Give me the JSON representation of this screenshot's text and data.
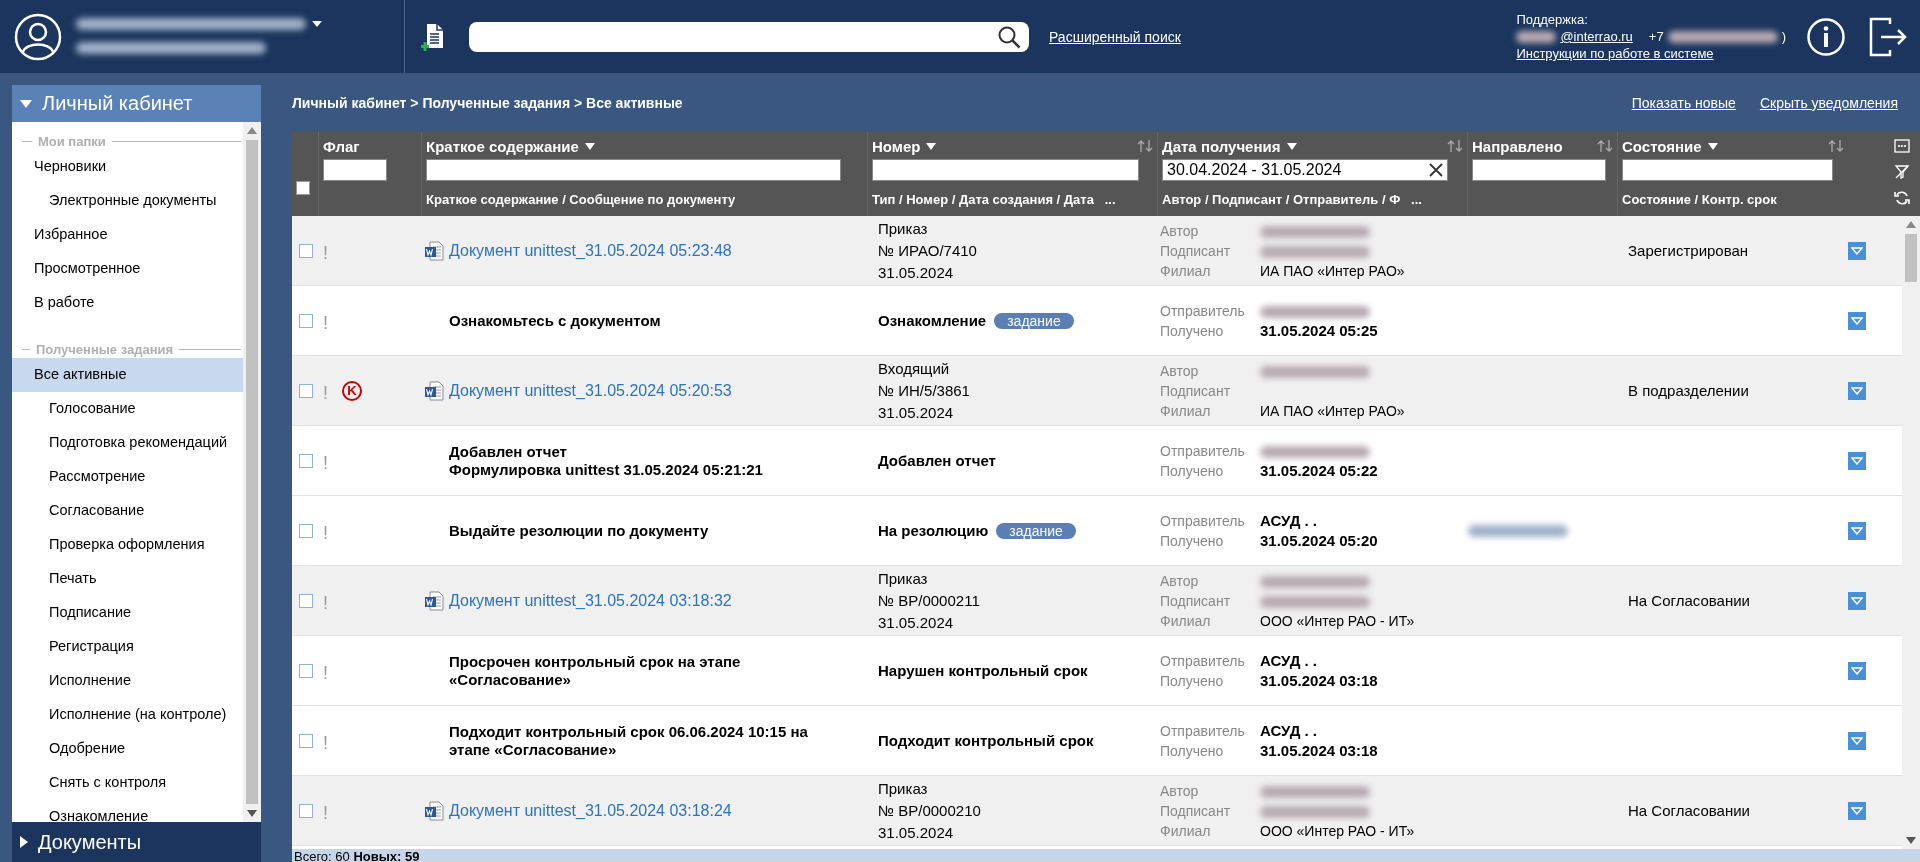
{
  "header": {
    "user": {
      "name_redacted": true,
      "org_redacted": true
    },
    "advanced_search": "Расширенный поиск",
    "support": {
      "label": "Поддержка:",
      "email_redacted": true,
      "email": "@interrao.ru",
      "phone": "+7",
      "phone_redacted": true,
      "phone_end": ")",
      "link": "Инструкции по работе в системе"
    }
  },
  "sidebar": {
    "panels": [
      {
        "title": "Личный кабинет",
        "expanded": true,
        "sections": [
          {
            "title": "Мои папки",
            "items": [
              {
                "label": "Черновики",
                "selected": false,
                "children": [
                  {
                    "label": "Электронные документы",
                    "selected": false
                  }
                ]
              },
              {
                "label": "Избранное",
                "selected": false
              },
              {
                "label": "Просмотренное",
                "selected": false
              },
              {
                "label": "В работе",
                "selected": false
              }
            ]
          },
          {
            "title": "Полученные задания",
            "items": [
              {
                "label": "Все активные",
                "selected": true,
                "children": [
                  {
                    "label": "Голосование",
                    "selected": false
                  },
                  {
                    "label": "Подготовка рекомендаций",
                    "selected": false
                  },
                  {
                    "label": "Рассмотрение",
                    "selected": false
                  },
                  {
                    "label": "Согласование",
                    "selected": false
                  },
                  {
                    "label": "Проверка оформления",
                    "selected": false
                  },
                  {
                    "label": "Печать",
                    "selected": false
                  },
                  {
                    "label": "Подписание",
                    "selected": false
                  },
                  {
                    "label": "Регистрация",
                    "selected": false
                  },
                  {
                    "label": "Исполнение",
                    "selected": false
                  },
                  {
                    "label": "Исполнение (на контроле)",
                    "selected": false
                  },
                  {
                    "label": "Одобрение",
                    "selected": false
                  },
                  {
                    "label": "Снять с контроля",
                    "selected": false
                  },
                  {
                    "label": "Ознакомление",
                    "selected": false
                  }
                ]
              }
            ]
          }
        ]
      },
      {
        "title": "Документы",
        "expanded": false
      }
    ]
  },
  "breadcrumb": "Личный кабинет > Полученные задания > Все активные",
  "actions": [
    "Показать новые",
    "Скрыть уведомления"
  ],
  "table": {
    "select_all": {
      "checked": false
    },
    "columns": [
      {
        "label": "Флаг",
        "menu": false,
        "sortable": false
      },
      {
        "label": "Краткое содержание",
        "menu": true,
        "sortable": false,
        "subheader": "Краткое содержание / Сообщение по документу"
      },
      {
        "label": "Номер",
        "menu": true,
        "sortable": true,
        "subheader": "Тип / Номер / Дата создания / Дата   ..."
      },
      {
        "label": "Дата получения",
        "menu": true,
        "sortable": true,
        "filter_value": "30.04.2024 - 31.05.2024",
        "clearable": true,
        "subheader": "Автор / Подписант / Отправитель / Ф   ..."
      },
      {
        "label": "Направлено",
        "menu": false,
        "sortable": true
      },
      {
        "label": "Состояние",
        "menu": true,
        "sortable": true,
        "subheader": "Состояние / Контр. срок"
      }
    ],
    "rows": [
      {
        "kind": "document",
        "checked": false,
        "flag": "!",
        "title": "Документ unittest_31.05.2024 05:23:48",
        "type": "Приказ",
        "number": "№ ИРАО/7410",
        "date": "31.05.2024",
        "people": [
          {
            "label": "Автор",
            "redacted": true
          },
          {
            "label": "Подписант",
            "redacted": true
          },
          {
            "label": "Филиал",
            "value": "ИА ПАО «Интер РАО»"
          }
        ],
        "status": "Зарегистрирован"
      },
      {
        "kind": "task",
        "checked": false,
        "flag": "!",
        "title": "Ознакомьтесь с документом",
        "task_type": "Ознакомление",
        "badge": "задание",
        "people": [
          {
            "label": "Отправитель",
            "redacted": true
          },
          {
            "label": "Получено",
            "value": "31.05.2024 05:25"
          }
        ]
      },
      {
        "kind": "document",
        "checked": false,
        "flag": "!",
        "control": "K",
        "title": "Документ unittest_31.05.2024 05:20:53",
        "type": "Входящий",
        "number": "№ ИН/5/3861",
        "date": "31.05.2024",
        "people": [
          {
            "label": "Автор",
            "redacted": true
          },
          {
            "label": "Подписант"
          },
          {
            "label": "Филиал",
            "value": "ИА ПАО «Интер РАО»"
          }
        ],
        "status": "В подразделении"
      },
      {
        "kind": "task",
        "checked": false,
        "flag": "!",
        "title": "Добавлен отчет\nФормулировка unittest 31.05.2024 05:21:21",
        "task_type": "Добавлен отчет",
        "people": [
          {
            "label": "Отправитель",
            "redacted": true
          },
          {
            "label": "Получено",
            "value": "31.05.2024 05:22"
          }
        ]
      },
      {
        "kind": "task",
        "checked": false,
        "flag": "!",
        "title": "Выдайте резолюции по документу",
        "task_type": "На резолюцию",
        "badge": "задание",
        "people": [
          {
            "label": "Отправитель",
            "value": "АСУД . ."
          },
          {
            "label": "Получено",
            "value": "31.05.2024 05:20"
          }
        ],
        "directed_redacted": true
      },
      {
        "kind": "document",
        "checked": false,
        "flag": "!",
        "title": "Документ unittest_31.05.2024 03:18:32",
        "type": "Приказ",
        "number": "№ ВР/0000211",
        "date": "31.05.2024",
        "people": [
          {
            "label": "Автор",
            "redacted": true
          },
          {
            "label": "Подписант",
            "redacted": true
          },
          {
            "label": "Филиал",
            "value": "ООО «Интер РАО - ИТ»"
          }
        ],
        "status": "На Согласовании"
      },
      {
        "kind": "task",
        "checked": false,
        "flag": "!",
        "title": "Просрочен контрольный срок на этапе «Согласование»",
        "task_type": "Нарушен контрольный срок",
        "people": [
          {
            "label": "Отправитель",
            "value": "АСУД . ."
          },
          {
            "label": "Получено",
            "value": "31.05.2024 03:18"
          }
        ]
      },
      {
        "kind": "task",
        "checked": false,
        "flag": "!",
        "title": "Подходит контрольный срок 06.06.2024 10:15 на этапе «Согласование»",
        "task_type": "Подходит контрольный срок",
        "people": [
          {
            "label": "Отправитель",
            "value": "АСУД . ."
          },
          {
            "label": "Получено",
            "value": "31.05.2024 03:18"
          }
        ]
      },
      {
        "kind": "document",
        "checked": false,
        "flag": "!",
        "title": "Документ unittest_31.05.2024 03:18:24",
        "type": "Приказ",
        "number": "№ ВР/0000210",
        "date": "31.05.2024",
        "people": [
          {
            "label": "Автор",
            "redacted": true
          },
          {
            "label": "Подписант",
            "redacted": true
          },
          {
            "label": "Филиал",
            "value": "ООО «Интер РАО - ИТ»"
          }
        ],
        "status": "На Согласовании"
      }
    ]
  },
  "footer": "Всего: 60 **Новых: 59**"
}
